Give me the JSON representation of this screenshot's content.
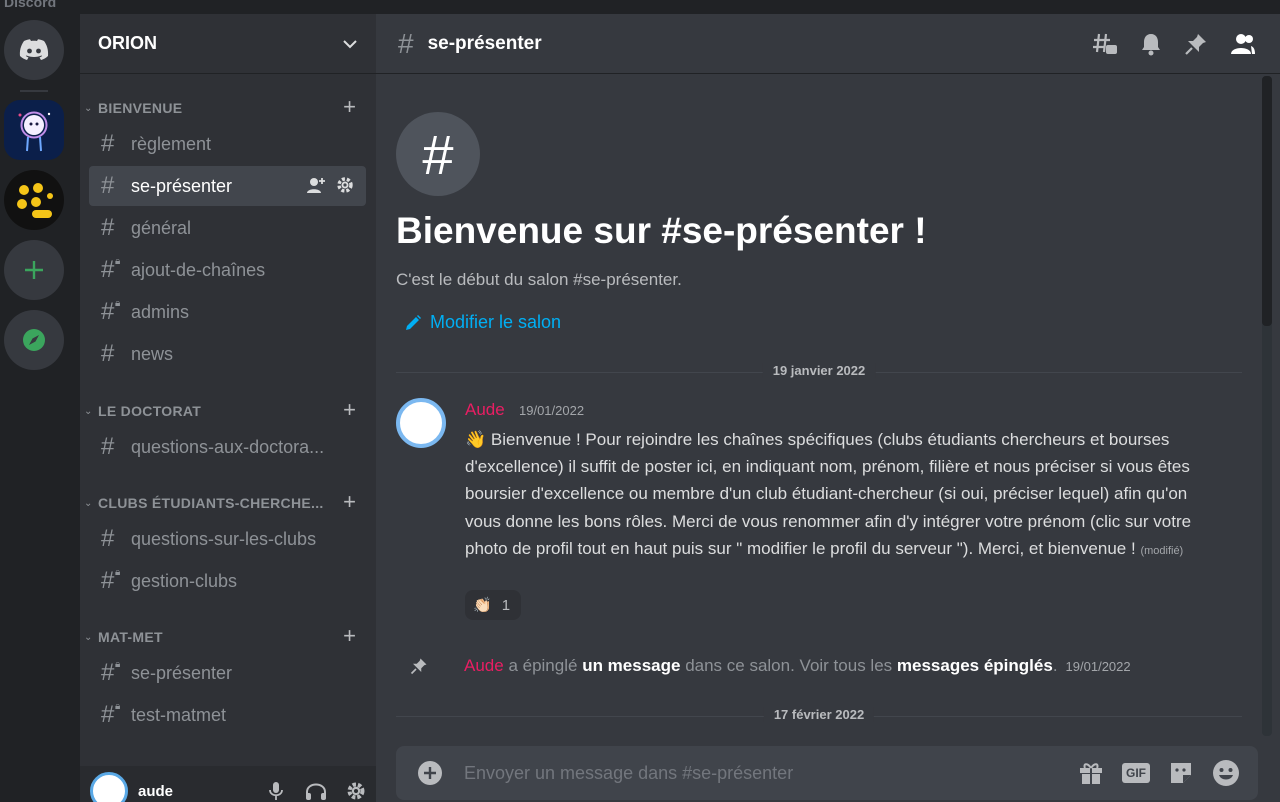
{
  "window": {
    "app_name": "Discord"
  },
  "rail": {
    "home_icon": "discord-logo-icon",
    "servers": [
      {
        "name": "server-orion",
        "icon": "astronaut-avatar-icon"
      },
      {
        "name": "server-yellow-dots",
        "icon": "yellow-dots-icon"
      }
    ],
    "add_icon": "plus-icon",
    "explore_icon": "compass-icon",
    "colors": {
      "add": "#3ba55d",
      "explore": "#3ba55d"
    }
  },
  "guild": {
    "name": "ORION"
  },
  "categories": [
    {
      "label": "BIENVENUE",
      "channels": [
        {
          "label": "règlement",
          "locked": false
        },
        {
          "label": "se-présenter",
          "locked": false,
          "active": true
        },
        {
          "label": "général",
          "locked": false
        },
        {
          "label": "ajout-de-chaînes",
          "locked": true
        },
        {
          "label": "admins",
          "locked": true
        },
        {
          "label": "news",
          "locked": false
        }
      ]
    },
    {
      "label": "LE DOCTORAT",
      "channels": [
        {
          "label": "questions-aux-doctora...",
          "locked": false
        }
      ]
    },
    {
      "label": "CLUBS ÉTUDIANTS-CHERCHE...",
      "channels": [
        {
          "label": "questions-sur-les-clubs",
          "locked": false
        },
        {
          "label": "gestion-clubs",
          "locked": true
        }
      ]
    },
    {
      "label": "MAT-MET",
      "channels": [
        {
          "label": "se-présenter",
          "locked": true
        },
        {
          "label": "test-matmet",
          "locked": true
        }
      ]
    }
  ],
  "user": {
    "name": "aude"
  },
  "header": {
    "channel": "se-présenter"
  },
  "welcome": {
    "title": "Bienvenue sur #se-présenter !",
    "subtitle": "C'est le début du salon #se-présenter.",
    "edit_label": "Modifier le salon"
  },
  "dividers": {
    "first": "19 janvier 2022",
    "second": "17 février 2022"
  },
  "message": {
    "author": "Aude",
    "time": "19/01/2022",
    "emoji": "👋",
    "text": "Bienvenue ! Pour rejoindre les chaînes spécifiques (clubs étudiants chercheurs et bourses d'excellence) il suffit de poster ici, en indiquant nom, prénom, filière et nous préciser si vous êtes boursier d'excellence ou membre d'un club étudiant-chercheur (si oui, préciser lequel) afin qu'on vous donne les bons rôles.  Merci de vous renommer afin d'y intégrer votre prénom (clic sur votre photo de profil tout en haut puis sur \" modifier le profil du serveur \").  Merci, et bienvenue !",
    "edited": "(modifié)",
    "reaction": {
      "emoji": "👏🏻",
      "count": "1"
    }
  },
  "pin": {
    "author": "Aude",
    "t1": "a épinglé",
    "b1": "un message",
    "t2": "dans ce salon. Voir tous les",
    "b2": "messages épinglés",
    "t3": ".",
    "time": "19/01/2022"
  },
  "composer": {
    "placeholder": "Envoyer un message dans #se-présenter",
    "gif": "GIF"
  }
}
